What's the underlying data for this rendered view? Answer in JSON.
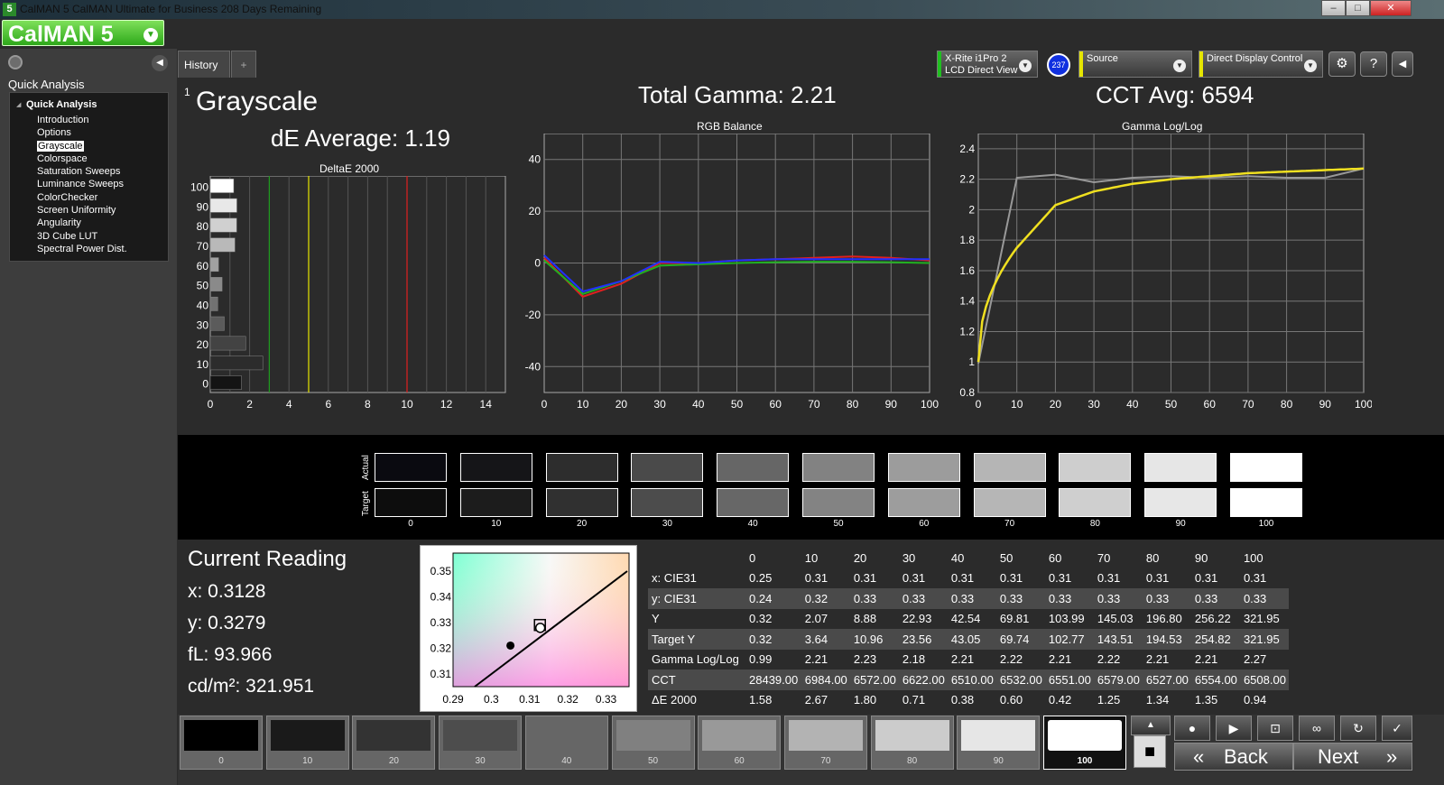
{
  "window": {
    "title": "CalMAN 5 CalMAN Ultimate for Business 208 Days Remaining",
    "app_icon": "5",
    "logo": "CalMAN 5"
  },
  "sidebar": {
    "section": "Quick Analysis",
    "root": "Quick Analysis",
    "items": [
      "Introduction",
      "Options",
      "Grayscale",
      "Colorspace",
      "Saturation Sweeps",
      "Luminance Sweeps",
      "ColorChecker",
      "Screen Uniformity",
      "Angularity",
      "3D Cube LUT",
      "Spectral Power Dist."
    ],
    "selected": "Grayscale"
  },
  "tabs": {
    "history": "History 1",
    "add": "+"
  },
  "devices": {
    "meter_line1": "X-Rite i1Pro 2",
    "meter_line2": "LCD Direct View",
    "meter_badge": "237",
    "source": "Source",
    "display": "Direct Display Control"
  },
  "summary": {
    "title": "Grayscale",
    "de_avg": "dE Average: 1.19",
    "gamma": "Total Gamma: 2.21",
    "cct": "CCT Avg: 6594"
  },
  "deltaE_chart": {
    "title": "DeltaE 2000",
    "levels": [
      "100",
      "90",
      "80",
      "70",
      "60",
      "50",
      "40",
      "30",
      "20",
      "10",
      "0"
    ],
    "values": [
      1.19,
      1.35,
      1.34,
      1.25,
      0.42,
      0.6,
      0.38,
      0.71,
      1.8,
      2.67,
      1.58
    ],
    "xticks": [
      "0",
      "2",
      "4",
      "6",
      "8",
      "10",
      "12",
      "14"
    ],
    "xmax": 15,
    "thresholds": [
      {
        "value": 3,
        "color": "#1f9a1f"
      },
      {
        "value": 5,
        "color": "#e6e600"
      },
      {
        "value": 10,
        "color": "#e02020"
      }
    ]
  },
  "chart_data": [
    {
      "type": "line",
      "title": "RGB Balance",
      "x": [
        0,
        10,
        20,
        30,
        40,
        50,
        60,
        70,
        80,
        90,
        100
      ],
      "xticks": [
        "0",
        "10",
        "20",
        "30",
        "40",
        "50",
        "60",
        "70",
        "80",
        "90",
        "100"
      ],
      "yticks": [
        "40",
        "20",
        "0",
        "-20",
        "-40"
      ],
      "ylim": [
        -50,
        50
      ],
      "series": [
        {
          "color": "#e02020",
          "values": [
            2,
            -13,
            -8,
            0,
            0,
            1,
            1.5,
            2,
            2.5,
            2,
            1
          ]
        },
        {
          "color": "#20b020",
          "values": [
            1,
            -12,
            -7,
            -1,
            -0.5,
            0,
            0.3,
            0.5,
            0.5,
            0.3,
            0
          ]
        },
        {
          "color": "#2030ff",
          "values": [
            3,
            -11,
            -7,
            0.5,
            0,
            1,
            1.5,
            1.5,
            1.5,
            1.5,
            1.5
          ]
        }
      ]
    },
    {
      "type": "line",
      "title": "Gamma Log/Log",
      "x": [
        0,
        10,
        20,
        30,
        40,
        50,
        60,
        70,
        80,
        90,
        100
      ],
      "xticks": [
        "0",
        "10",
        "20",
        "30",
        "40",
        "50",
        "60",
        "70",
        "80",
        "90",
        "100"
      ],
      "yticks": [
        "2.4",
        "2.2",
        "2",
        "1.8",
        "1.6",
        "1.4",
        "1.2",
        "1",
        "0.8"
      ],
      "ylim": [
        0.8,
        2.5
      ],
      "series": [
        {
          "color": "#999999",
          "values": [
            0.99,
            2.21,
            2.23,
            2.18,
            2.21,
            2.22,
            2.21,
            2.22,
            2.21,
            2.21,
            2.27
          ]
        },
        {
          "color": "#f0e020",
          "values": [
            1.0,
            1.75,
            2.03,
            2.12,
            2.17,
            2.2,
            2.22,
            2.24,
            2.25,
            2.26,
            2.27
          ]
        }
      ]
    },
    {
      "type": "scatter",
      "title": "",
      "xticks": [
        "0.29",
        "0.3",
        "0.31",
        "0.32",
        "0.33"
      ],
      "yticks": [
        "0.35",
        "0.34",
        "0.33",
        "0.32",
        "0.31"
      ],
      "xlim": [
        0.29,
        0.336
      ],
      "ylim": [
        0.305,
        0.357
      ],
      "target": [
        0.3127,
        0.329
      ],
      "reading": [
        0.3128,
        0.3279
      ],
      "black_point": [
        0.305,
        0.321
      ]
    }
  ],
  "swatches": {
    "actual_label": "Actual",
    "target_label": "Target",
    "levels": [
      "0",
      "10",
      "20",
      "30",
      "40",
      "50",
      "60",
      "70",
      "80",
      "90",
      "100"
    ],
    "actual": [
      "#0a0a10",
      "#151518",
      "#2d2d2d",
      "#4a4a4a",
      "#666666",
      "#828282",
      "#9c9c9c",
      "#b5b5b5",
      "#cecece",
      "#e6e6e6",
      "#ffffff"
    ],
    "target": [
      "#0d0d0d",
      "#1c1c1c",
      "#303030",
      "#4c4c4c",
      "#676767",
      "#838383",
      "#9d9d9d",
      "#b6b6b6",
      "#cfcfcf",
      "#e7e7e7",
      "#ffffff"
    ]
  },
  "reading": {
    "head": "Current Reading",
    "x": "x: 0.3128",
    "y": "y: 0.3279",
    "fl": "fL: 93.966",
    "cd": "cd/m²: 321.951"
  },
  "table": {
    "header": [
      "",
      "0",
      "10",
      "20",
      "30",
      "40",
      "50",
      "60",
      "70",
      "80",
      "90",
      "100"
    ],
    "rows": [
      [
        "x: CIE31",
        "0.25",
        "0.31",
        "0.31",
        "0.31",
        "0.31",
        "0.31",
        "0.31",
        "0.31",
        "0.31",
        "0.31",
        "0.31"
      ],
      [
        "y: CIE31",
        "0.24",
        "0.32",
        "0.33",
        "0.33",
        "0.33",
        "0.33",
        "0.33",
        "0.33",
        "0.33",
        "0.33",
        "0.33"
      ],
      [
        "Y",
        "0.32",
        "2.07",
        "8.88",
        "22.93",
        "42.54",
        "69.81",
        "103.99",
        "145.03",
        "196.80",
        "256.22",
        "321.95"
      ],
      [
        "Target Y",
        "0.32",
        "3.64",
        "10.96",
        "23.56",
        "43.05",
        "69.74",
        "102.77",
        "143.51",
        "194.53",
        "254.82",
        "321.95"
      ],
      [
        "Gamma Log/Log",
        "0.99",
        "2.21",
        "2.23",
        "2.18",
        "2.21",
        "2.22",
        "2.21",
        "2.22",
        "2.21",
        "2.21",
        "2.27"
      ],
      [
        "CCT",
        "28439.00",
        "6984.00",
        "6572.00",
        "6622.00",
        "6510.00",
        "6532.00",
        "6551.00",
        "6579.00",
        "6527.00",
        "6554.00",
        "6508.00"
      ],
      [
        "ΔE 2000",
        "1.58",
        "2.67",
        "1.80",
        "0.71",
        "0.38",
        "0.60",
        "0.42",
        "1.25",
        "1.34",
        "1.35",
        "0.94"
      ]
    ]
  },
  "bottom": {
    "levels": [
      "0",
      "10",
      "20",
      "30",
      "40",
      "50",
      "60",
      "70",
      "80",
      "90",
      "100"
    ],
    "colors": [
      "#000000",
      "#1a1a1a",
      "#333333",
      "#4d4d4d",
      "#666666",
      "#808080",
      "#999999",
      "#b3b3b3",
      "#cccccc",
      "#e6e6e6",
      "#ffffff"
    ],
    "selected": "100",
    "back": "Back",
    "next": "Next",
    "back_icon": "«",
    "next_icon": "»"
  }
}
